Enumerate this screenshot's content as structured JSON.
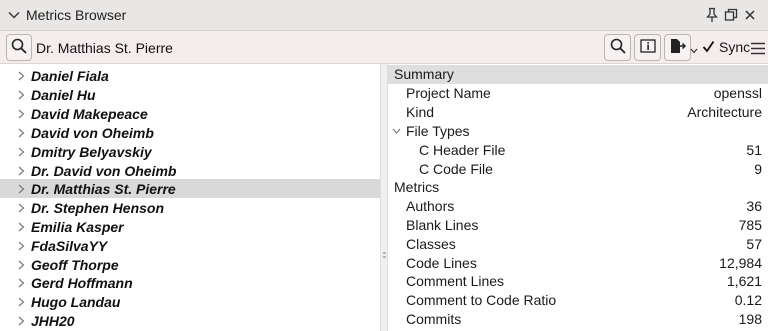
{
  "window": {
    "title": "Metrics Browser"
  },
  "toolbar": {
    "search_value": "Dr. Matthias St. Pierre",
    "sync_label": "Sync",
    "sync_checked": true
  },
  "authors": [
    {
      "name": "Daniel Fiala",
      "selected": false
    },
    {
      "name": "Daniel Hu",
      "selected": false
    },
    {
      "name": "David Makepeace",
      "selected": false
    },
    {
      "name": "David von Oheimb",
      "selected": false
    },
    {
      "name": "Dmitry Belyavskiy",
      "selected": false
    },
    {
      "name": "Dr. David von Oheimb",
      "selected": false
    },
    {
      "name": "Dr. Matthias St. Pierre",
      "selected": true
    },
    {
      "name": "Dr. Stephen Henson",
      "selected": false
    },
    {
      "name": "Emilia Kasper",
      "selected": false
    },
    {
      "name": "FdaSilvaYY",
      "selected": false
    },
    {
      "name": "Geoff Thorpe",
      "selected": false
    },
    {
      "name": "Gerd Hoffmann",
      "selected": false
    },
    {
      "name": "Hugo Landau",
      "selected": false
    },
    {
      "name": "JHH20",
      "selected": false
    }
  ],
  "metrics_panel": {
    "summary_header": "Summary",
    "project_name_label": "Project Name",
    "project_name_value": "openssl",
    "kind_label": "Kind",
    "kind_value": "Architecture",
    "file_types_label": "File Types",
    "c_header_label": "C Header File",
    "c_header_value": "51",
    "c_code_label": "C Code File",
    "c_code_value": "9",
    "metrics_header": "Metrics",
    "rows": [
      {
        "label": "Authors",
        "value": "36"
      },
      {
        "label": "Blank Lines",
        "value": "785"
      },
      {
        "label": "Classes",
        "value": "57"
      },
      {
        "label": "Code Lines",
        "value": "12,984"
      },
      {
        "label": "Comment Lines",
        "value": "1,621"
      },
      {
        "label": "Comment to Code Ratio",
        "value": "0.12"
      },
      {
        "label": "Commits",
        "value": "198"
      }
    ]
  }
}
